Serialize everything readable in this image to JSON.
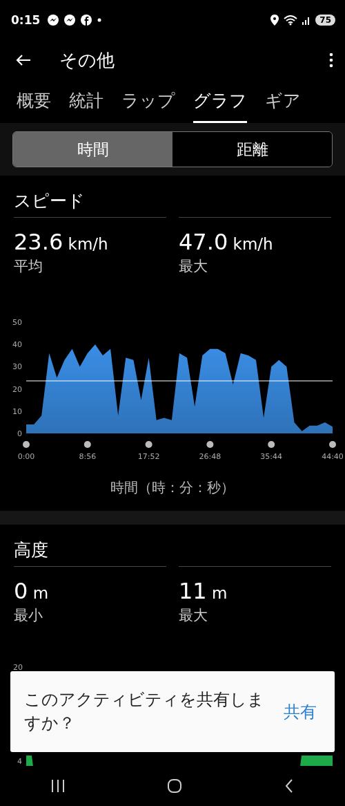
{
  "status_bar": {
    "time": "0:15",
    "battery": "75"
  },
  "app_bar": {
    "title": "その他"
  },
  "tabs": [
    {
      "label": "概要",
      "selected": false
    },
    {
      "label": "統計",
      "selected": false
    },
    {
      "label": "ラップ",
      "selected": false
    },
    {
      "label": "グラフ",
      "selected": true
    },
    {
      "label": "ギア",
      "selected": false
    }
  ],
  "segments": [
    {
      "label": "時間",
      "selected": true
    },
    {
      "label": "距離",
      "selected": false
    }
  ],
  "sections": [
    {
      "title": "スピード",
      "stats": [
        {
          "value": "23.6",
          "unit": "km/h",
          "label": "平均"
        },
        {
          "value": "47.0",
          "unit": "km/h",
          "label": "最大"
        }
      ],
      "chart_data": {
        "type": "area",
        "xlabel": "時間（時：分：秒）",
        "xlim": [
          0,
          2680
        ],
        "ylim": [
          0,
          50
        ],
        "x": [
          0,
          67,
          134,
          201,
          268,
          335,
          402,
          469,
          536,
          603,
          670,
          737,
          804,
          871,
          938,
          1005,
          1072,
          1139,
          1206,
          1273,
          1340,
          1407,
          1474,
          1541,
          1608,
          1675,
          1742,
          1809,
          1876,
          1943,
          2010,
          2077,
          2144,
          2211,
          2278,
          2345,
          2412,
          2479,
          2546,
          2613,
          2680
        ],
        "series": [
          {
            "color": "#3a8ee6",
            "values": [
              4,
              4,
              8,
              36,
              25,
              33,
              38,
              30,
              36,
              40,
              35,
              38,
              8,
              34,
              33,
              15,
              34,
              6,
              7,
              6,
              36,
              34,
              12,
              35,
              38,
              38,
              36,
              22,
              36,
              35,
              33,
              7,
              30,
              33,
              30,
              5,
              1,
              3.5,
              3.5,
              5,
              3
            ]
          }
        ],
        "xticks": [
          {
            "value": 0,
            "label": "0:00"
          },
          {
            "value": 536,
            "label": "8:56"
          },
          {
            "value": 1072,
            "label": "17:52"
          },
          {
            "value": 1608,
            "label": "26:48"
          },
          {
            "value": 2144,
            "label": "35:44"
          },
          {
            "value": 2680,
            "label": "44:40"
          }
        ],
        "yticks": [
          0,
          10,
          20,
          30,
          40,
          50
        ],
        "ref_lines": [
          {
            "axis": "y",
            "value": 23.6
          }
        ]
      }
    },
    {
      "title": "高度",
      "stats": [
        {
          "value": "0",
          "unit": "m",
          "label": "最小"
        },
        {
          "value": "11",
          "unit": "m",
          "label": "最大"
        }
      ],
      "chart": {
        "y_ticks": [
          "20",
          "4"
        ]
      }
    }
  ],
  "snackbar": {
    "message": "このアクティビティを共有しますか？",
    "action": "共有"
  }
}
